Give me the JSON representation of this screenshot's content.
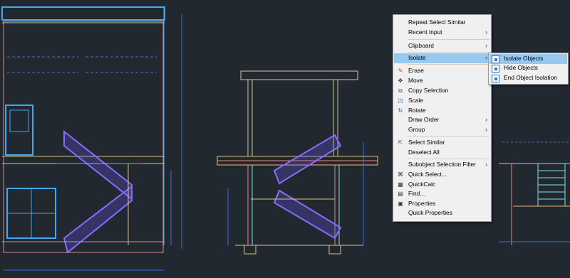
{
  "colors": {
    "background": "#212830",
    "menu_bg": "#f0f0f0",
    "highlight": "#99c9ef"
  },
  "context_menu": {
    "items": [
      {
        "label": "Repeat Select Similar",
        "submenu": false,
        "icon": ""
      },
      {
        "label": "Recent Input",
        "submenu": true,
        "icon": ""
      },
      {
        "label": "Clipboard",
        "submenu": true,
        "icon": ""
      },
      {
        "label": "Isolate",
        "submenu": true,
        "icon": "",
        "highlighted": true
      },
      {
        "label": "Erase",
        "icon": "erase-icon"
      },
      {
        "label": "Move",
        "icon": "move-icon"
      },
      {
        "label": "Copy Selection",
        "icon": "copy-icon"
      },
      {
        "label": "Scale",
        "icon": "scale-icon"
      },
      {
        "label": "Rotate",
        "icon": "rotate-icon"
      },
      {
        "label": "Draw Order",
        "submenu": true,
        "icon": ""
      },
      {
        "label": "Group",
        "submenu": true,
        "icon": ""
      },
      {
        "label": "Select Similar",
        "icon": "select-similar-icon"
      },
      {
        "label": "Deselect All",
        "icon": ""
      },
      {
        "label": "Subobject Selection Filter",
        "submenu": true,
        "icon": ""
      },
      {
        "label": "Quick Select...",
        "icon": "quick-select-icon"
      },
      {
        "label": "QuickCalc",
        "icon": "calculator-icon"
      },
      {
        "label": "Find...",
        "icon": "find-icon"
      },
      {
        "label": "Properties",
        "icon": "properties-icon"
      },
      {
        "label": "Quick Properties",
        "icon": ""
      }
    ]
  },
  "submenu": {
    "items": [
      {
        "label": "Isolate Objects",
        "highlighted": true
      },
      {
        "label": "Hide Objects"
      },
      {
        "label": "End Object Isolation"
      }
    ]
  }
}
